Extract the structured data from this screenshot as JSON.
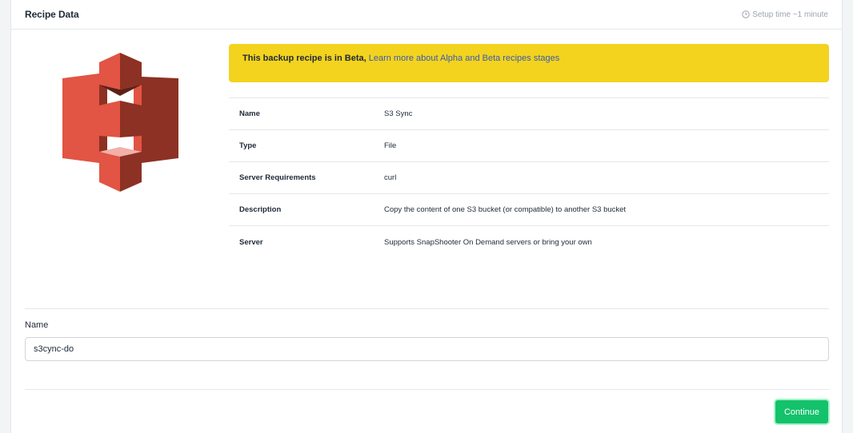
{
  "header": {
    "title": "Recipe Data",
    "setup_time": "Setup time ~1 minute",
    "clock_icon": "clock-icon"
  },
  "logo": {
    "icon": "aws-s3-logo-icon",
    "primary_color": "#e25444",
    "dark_color": "#8c3123",
    "light_color": "#f2b0a9"
  },
  "beta_banner": {
    "bold_text": "This backup recipe is in Beta,",
    "link_text": "Learn more about Alpha and Beta recipes stages",
    "background": "#f3d31e"
  },
  "details": [
    {
      "key": "Name",
      "value": "S3 Sync"
    },
    {
      "key": "Type",
      "value": "File"
    },
    {
      "key": "Server Requirements",
      "value": "curl"
    },
    {
      "key": "Description",
      "value": "Copy the content of one S3 bucket (or compatible) to another S3 bucket"
    },
    {
      "key": "Server",
      "value": "Supports SnapShooter On Demand servers or bring your own"
    }
  ],
  "form": {
    "name_label": "Name",
    "name_value": "s3cync-do"
  },
  "actions": {
    "continue_label": "Continue",
    "continue_color": "#13c26b"
  }
}
